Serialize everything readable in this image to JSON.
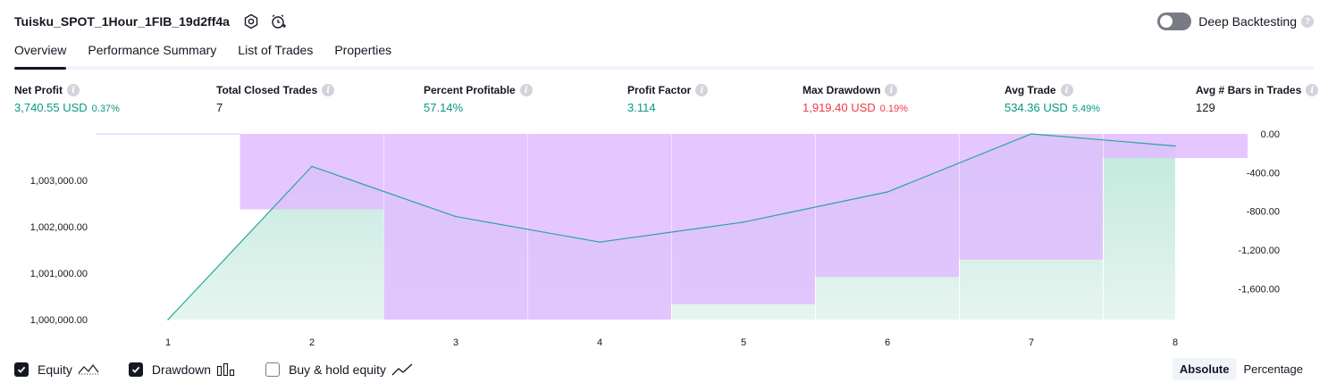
{
  "header": {
    "strategy_name": "Tuisku_SPOT_1Hour_1FIB_19d2ff4a",
    "deep_backtesting_label": "Deep Backtesting",
    "deep_backtesting_enabled": false,
    "help_glyph": "?",
    "icons": [
      "settings-icon",
      "alarm-add-icon",
      "help-icon"
    ]
  },
  "tabs": [
    {
      "label": "Overview",
      "active": true
    },
    {
      "label": "Performance Summary",
      "active": false
    },
    {
      "label": "List of Trades",
      "active": false
    },
    {
      "label": "Properties",
      "active": false
    }
  ],
  "metrics": [
    {
      "label": "Net Profit",
      "value": "3,740.55 USD",
      "pct": "0.37%",
      "color": "#089981"
    },
    {
      "label": "Total Closed Trades",
      "value": "7",
      "pct": "",
      "color": "#131722"
    },
    {
      "label": "Percent Profitable",
      "value": "57.14%",
      "pct": "",
      "color": "#089981"
    },
    {
      "label": "Profit Factor",
      "value": "3.114",
      "pct": "",
      "color": "#089981"
    },
    {
      "label": "Max Drawdown",
      "value": "1,919.40 USD",
      "pct": "0.19%",
      "color": "#f23645"
    },
    {
      "label": "Avg Trade",
      "value": "534.36 USD",
      "pct": "5.49%",
      "color": "#089981"
    },
    {
      "label": "Avg # Bars in Trades",
      "value": "129",
      "pct": "",
      "color": "#131722"
    }
  ],
  "info_glyph": "i",
  "chart_data": {
    "type": "area",
    "x": [
      1,
      2,
      3,
      4,
      5,
      6,
      7,
      8
    ],
    "series": [
      {
        "name": "Equity",
        "axis": "left",
        "values": [
          1000000,
          1003300,
          1002220,
          1001670,
          1002100,
          1002750,
          1004000,
          1003740
        ],
        "color": "#26a69a"
      },
      {
        "name": "Drawdown",
        "axis": "right",
        "values": [
          0,
          -780,
          -1919.4,
          -1919.4,
          -1760,
          -1480,
          -1300,
          -250
        ],
        "color": "#e1bcff"
      }
    ],
    "left_ticks": [
      "1,000,000.00",
      "1,001,000.00",
      "1,002,000.00",
      "1,003,000.00"
    ],
    "right_ticks": [
      "0.00",
      "-400.00",
      "-800.00",
      "-1,200.00",
      "-1,600.00"
    ],
    "left_ylim": [
      1000000,
      1004000
    ],
    "right_ylim": [
      -1919.4,
      0
    ],
    "colors": {
      "equity_line": "#26a69a",
      "equity_fill": "#c8ebe2",
      "drawdown_fill": "#e1bcff",
      "bar_gap": "#ffffff"
    }
  },
  "legend": [
    {
      "label": "Equity",
      "checked": true,
      "icon": "equity-line-icon"
    },
    {
      "label": "Drawdown",
      "checked": true,
      "icon": "drawdown-bars-icon"
    },
    {
      "label": "Buy & hold equity",
      "checked": false,
      "icon": "buy-hold-line-icon"
    }
  ],
  "view_mode": {
    "options": [
      "Absolute",
      "Percentage"
    ],
    "selected": "Absolute"
  }
}
